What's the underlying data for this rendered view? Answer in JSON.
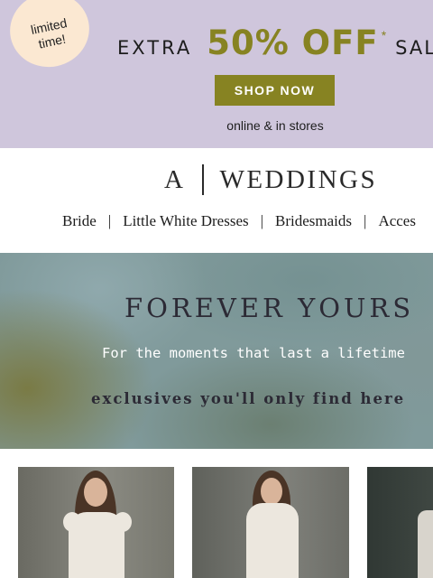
{
  "promo": {
    "badge_line1": "limited",
    "badge_line2": "time!",
    "extra": "EXTRA",
    "percent_off": "50% OFF",
    "asterisk": "*",
    "sale": "SALE",
    "shop_now_label": "SHOP NOW",
    "subtext": "online & in stores",
    "background_color": "#cfc6dc",
    "accent_color": "#878322",
    "badge_color": "#fbe8d2"
  },
  "header": {
    "brand_letter": "A",
    "brand_name": "WEDDINGS",
    "nav": [
      "Bride",
      "Little White Dresses",
      "Bridesmaids",
      "Acces"
    ],
    "nav_separator": "|"
  },
  "hero": {
    "title": "FOREVER YOURS",
    "subtitle": "For the moments that last a lifetime",
    "tagline": "exclusives you'll only find here"
  },
  "products": [
    {
      "image": "model-in-white-flutter-sleeve-dress"
    },
    {
      "image": "model-in-white-high-neck-dress"
    },
    {
      "image": "white-lace-dress-partial"
    }
  ]
}
